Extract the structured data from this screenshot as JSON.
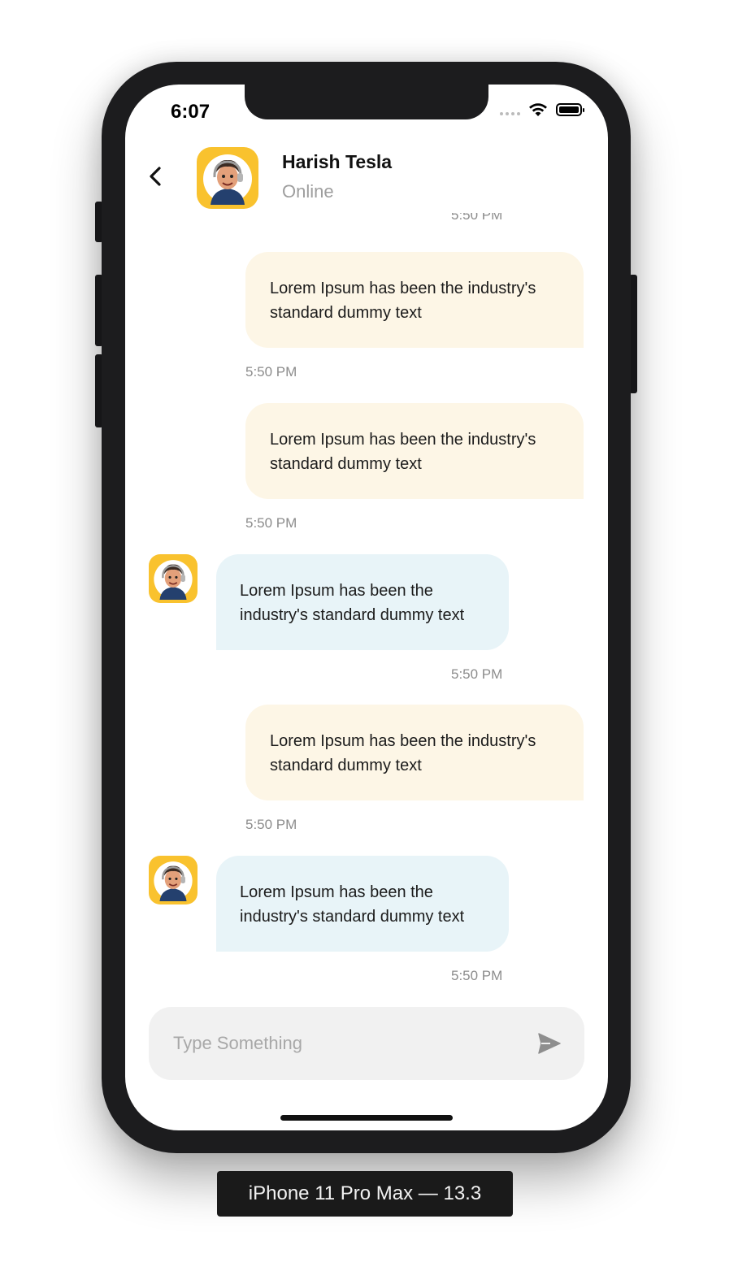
{
  "status_bar": {
    "time": "6:07"
  },
  "header": {
    "contact_name": "Harish Tesla",
    "contact_status": "Online"
  },
  "messages": [
    {
      "direction": "outgoing",
      "text": "",
      "time": "5:50 PM",
      "partial": true
    },
    {
      "direction": "outgoing",
      "text": "Lorem Ipsum has been the industry's standard dummy text",
      "time": "5:50 PM"
    },
    {
      "direction": "outgoing",
      "text": "Lorem Ipsum has been the industry's standard dummy text",
      "time": "5:50 PM"
    },
    {
      "direction": "incoming",
      "text": "Lorem Ipsum has been the industry's standard dummy text",
      "time": "5:50 PM"
    },
    {
      "direction": "outgoing",
      "text": "Lorem Ipsum has been the industry's standard dummy text",
      "time": "5:50 PM"
    },
    {
      "direction": "incoming",
      "text": "Lorem Ipsum has been the industry's standard dummy text",
      "time": "5:50 PM"
    }
  ],
  "composer": {
    "placeholder": "Type Something"
  },
  "device_label": "iPhone 11 Pro Max — 13.3",
  "colors": {
    "outgoing_bubble": "#fdf6e6",
    "incoming_bubble": "#e8f4f8",
    "avatar_bg": "#f9c22e",
    "composer_bg": "#f1f1f1"
  },
  "icons": [
    "back-chevron-icon",
    "wifi-icon",
    "battery-icon",
    "signal-icon",
    "send-icon",
    "avatar-icon"
  ]
}
